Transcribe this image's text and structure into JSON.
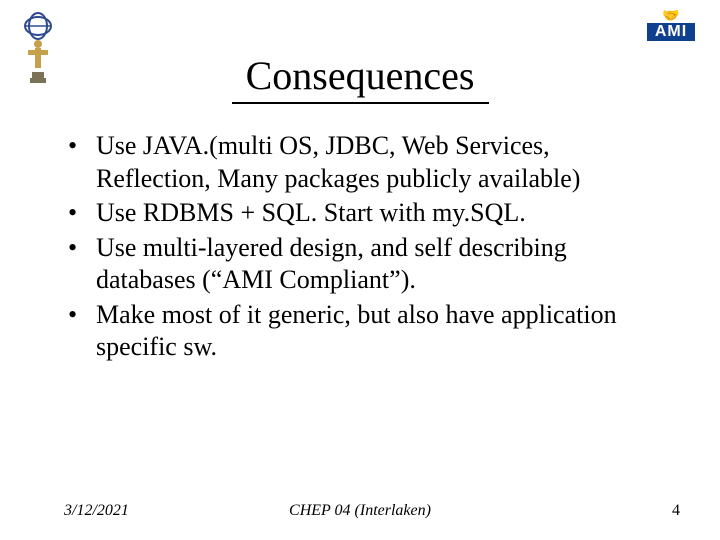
{
  "title": "Consequences",
  "bullets": [
    "Use JAVA.(multi OS, JDBC, Web Services, Reflection, Many packages publicly available)",
    "Use RDBMS + SQL. Start with my.SQL.",
    "Use multi-layered design, and self describing databases (“AMI Compliant”).",
    "Make most of it generic, but also have application specific sw."
  ],
  "footer": {
    "date": "3/12/2021",
    "center": "CHEP 04 (Interlaken)",
    "page": "4"
  },
  "logos": {
    "left_name": "atlas-logo",
    "right_text": "AMI",
    "right_emoji": "🤝"
  }
}
